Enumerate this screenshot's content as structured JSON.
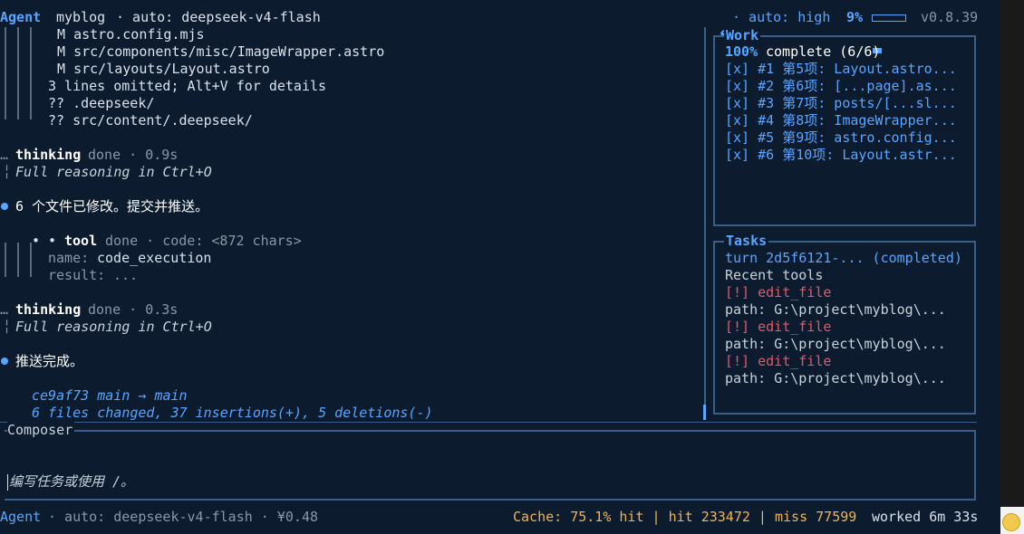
{
  "header": {
    "agent_label": "Agent",
    "project": "myblog",
    "model": "· auto: deepseek-v4-flash",
    "mode": "· auto: high",
    "context_pct": "9%",
    "context_fill": 0.09,
    "version": "v0.8.39"
  },
  "transcript": {
    "file_lines": [
      " M astro.config.mjs",
      " M src/components/misc/ImageWrapper.astro",
      " M src/layouts/Layout.astro",
      "3 lines omitted; Alt+V for details",
      "?? .deepseek/",
      "?? src/content/.deepseek/"
    ],
    "thinking1": {
      "label": "thinking",
      "status": "done · 0.9s",
      "hint": "Full reasoning in Ctrl+O"
    },
    "message1": "6 个文件已修改。提交并推送。",
    "tool": {
      "prefix": "• •",
      "label": "tool",
      "status": "done · code: <872 chars>",
      "name_key": "name:",
      "name_val": "code_execution",
      "result_key": "result:",
      "result_val": "..."
    },
    "thinking2": {
      "label": "thinking",
      "status": "done · 0.3s",
      "hint": "Full reasoning in Ctrl+O"
    },
    "message2": "推送完成。",
    "commit": {
      "hash": "ce9af73 main → main",
      "summary": "6 files changed, 37 insertions(+), 5 deletions(-)"
    }
  },
  "work": {
    "title": "Work",
    "percent": "100%",
    "summary": "complete (6/6)",
    "items": [
      "[x] #1 第5项: Layout.astro...",
      "[x] #2 第6项: [...page].as...",
      "[x] #3 第7项: posts/[...sl...",
      "[x] #4 第8项: ImageWrapper...",
      "[x] #5 第9项: astro.config...",
      "[x] #6 第10项: Layout.astr..."
    ]
  },
  "tasks": {
    "title": "Tasks",
    "turn": "turn 2d5f6121-... (completed)",
    "recent_label": "Recent tools",
    "tools": [
      {
        "flag": "[!] edit_file",
        "path": "path: G:\\project\\myblog\\..."
      },
      {
        "flag": "[!] edit_file",
        "path": "path: G:\\project\\myblog\\..."
      },
      {
        "flag": "[!] edit_file",
        "path": "path: G:\\project\\myblog\\..."
      }
    ]
  },
  "composer": {
    "title": "Composer",
    "placeholder": "编写任务或使用 /。"
  },
  "statusbar": {
    "agent": "Agent",
    "model": "· auto: deepseek-v4-flash · ¥0.48",
    "cache": "Cache: 75.1% hit | hit 233472 | miss 77599",
    "worked": "worked 6m 33s"
  },
  "colors": {
    "background": "#0c1b2e",
    "accent": "#5aa5ff",
    "border": "#3b5f86",
    "error": "#e05a6a",
    "cache": "#f0b456"
  }
}
